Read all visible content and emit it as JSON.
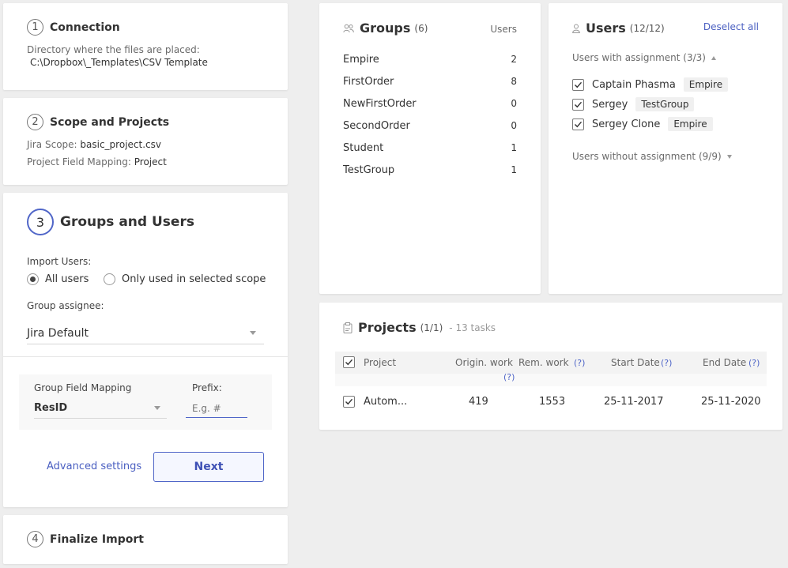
{
  "step1": {
    "num": "1",
    "title": "Connection",
    "dir_label": "Directory where the files are placed:",
    "dir_value": "C:\\Dropbox\\_Templates\\CSV Template"
  },
  "step2": {
    "num": "2",
    "title": "Scope and Projects",
    "scope_label": "Jira Scope:",
    "scope_value": "basic_project.csv",
    "mapping_label": "Project Field Mapping:",
    "mapping_value": "Project"
  },
  "step3": {
    "num": "3",
    "title": "Groups and Users",
    "import_label": "Import Users:",
    "radio_all": "All users",
    "radio_scope": "Only used in selected scope",
    "selected_radio": "all",
    "assignee_label": "Group assignee:",
    "assignee_value": "Jira Default",
    "mapping_label": "Group Field Mapping",
    "mapping_value": "ResID",
    "prefix_label": "Prefix:",
    "prefix_placeholder": "E.g. #",
    "advanced_link": "Advanced settings",
    "next_button": "Next"
  },
  "step4": {
    "num": "4",
    "title": "Finalize Import"
  },
  "groups": {
    "title": "Groups",
    "count": "(6)",
    "users_header": "Users",
    "items": [
      {
        "name": "Empire",
        "users": "2"
      },
      {
        "name": "FirstOrder",
        "users": "8"
      },
      {
        "name": "NewFirstOrder",
        "users": "0"
      },
      {
        "name": "SecondOrder",
        "users": "0"
      },
      {
        "name": "Student",
        "users": "1"
      },
      {
        "name": "TestGroup",
        "users": "1"
      }
    ]
  },
  "users": {
    "title": "Users",
    "count": "(12/12)",
    "deselect": "Deselect all",
    "with_assignment": "Users with assignment (3/3)",
    "without_assignment": "Users without assignment (9/9)",
    "items": [
      {
        "name": "Captain Phasma",
        "group": "Empire"
      },
      {
        "name": "Sergey",
        "group": "TestGroup"
      },
      {
        "name": "Sergey Clone",
        "group": "Empire"
      }
    ]
  },
  "projects": {
    "title": "Projects",
    "count": "(1/1)",
    "tasks": "- 13 tasks",
    "headers": {
      "project": "Project",
      "orig": "Origin. work",
      "rem": "Rem. work",
      "start": "Start Date",
      "end": "End Date",
      "help": "(?)"
    },
    "rows": [
      {
        "project": "Autom...",
        "orig": "419",
        "rem": "1553",
        "start": "25-11-2017",
        "end": "25-11-2020"
      }
    ]
  },
  "colors": {
    "accent": "#5066c8",
    "background": "#eeeeee"
  }
}
